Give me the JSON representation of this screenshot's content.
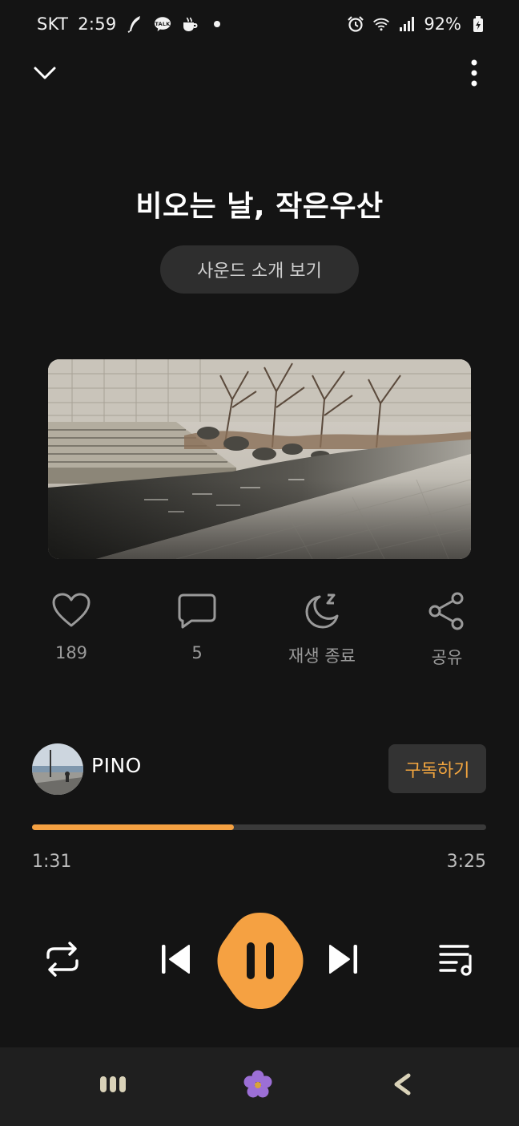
{
  "status_bar": {
    "carrier": "SKT",
    "time": "2:59",
    "notification_icons": [
      "feather-icon",
      "talk-icon",
      "coffee-icon",
      "dot-icon"
    ],
    "talk_badge": "TALK",
    "system_icons": [
      "alarm-icon",
      "wifi-icon",
      "signal-icon",
      "battery-icon"
    ],
    "battery": "92%"
  },
  "top_bar": {
    "collapse_icon": "chevron-down-icon",
    "menu_icon": "more-vertical-icon"
  },
  "track": {
    "title": "비오는 날, 작은우산",
    "intro_button": "사운드 소개 보기",
    "artwork": "photo of stream with stone steps and bare trees"
  },
  "actions": [
    {
      "icon": "heart-icon",
      "label": "189"
    },
    {
      "icon": "comment-icon",
      "label": "5"
    },
    {
      "icon": "sleep-timer-icon",
      "label": "재생 종료"
    },
    {
      "icon": "share-icon",
      "label": "공유"
    }
  ],
  "channel": {
    "name": "PINO",
    "subscribe_label": "구독하기"
  },
  "progress": {
    "current": "1:31",
    "total": "3:25",
    "fraction": 0.444
  },
  "controls": [
    "repeat-icon",
    "previous-icon",
    "pause-icon",
    "next-icon",
    "playlist-icon"
  ],
  "colors": {
    "accent": "#f5a142",
    "background": "#141414",
    "subscribe_text": "#f2a53f"
  },
  "nav_bar": [
    "recent-apps-icon",
    "home-flower-icon",
    "back-icon"
  ]
}
